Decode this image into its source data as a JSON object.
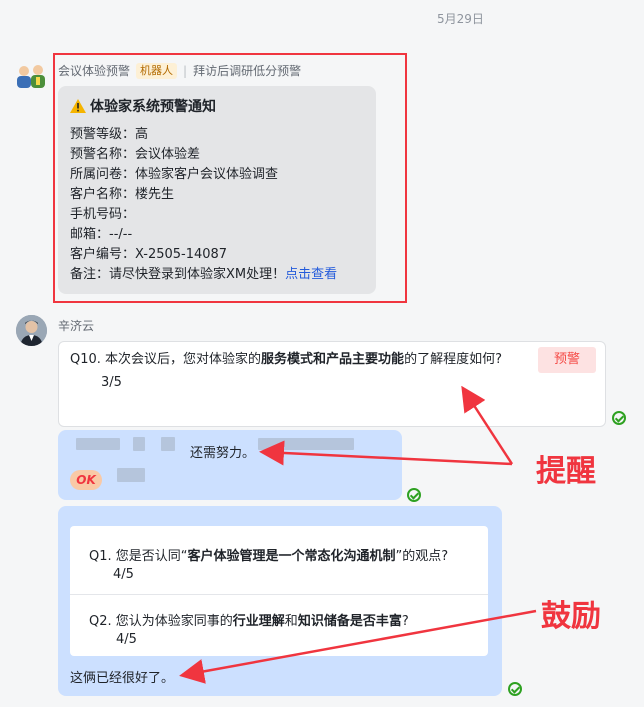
{
  "date_label": "5月29日",
  "robot_message": {
    "sender": "会议体验预警",
    "badge": "机器人",
    "subtitle": "拜访后调研低分预警",
    "card": {
      "title": "体验家系统预警通知",
      "rows": [
        "预警等级：高",
        "预警名称：会议体验差",
        "所属问卷：体验家客户会议体验调查",
        "客户名称：楼先生",
        "手机号码：",
        "邮箱：--/--",
        "客户编号：X-2505-14087"
      ],
      "note_prefix": "备注：请尽快登录到体验家XM处理！",
      "note_link": "点击查看"
    }
  },
  "person_message": {
    "sender": "辛济云",
    "q10": {
      "prefix": "Q10. 本次会议后，您对体验家的",
      "bold1": "服务模式和产品主要功能",
      "suffix": "的了解程度如何?",
      "score": "3/5",
      "tag": "预警"
    },
    "reply1": "还需努力。",
    "ok_badge": "OK",
    "q1": {
      "prefix": "Q1. 您是否认同“",
      "bold": "客户体验管理是一个常态化沟通机制",
      "suffix": "”的观点?",
      "score": "4/5"
    },
    "q2": {
      "prefix": "Q2. 您认为体验家同事的",
      "bold1": "行业理解",
      "mid": "和",
      "bold2": "知识储备是否丰富",
      "suffix": "?",
      "score": "4/5"
    },
    "reply2": "这俩已经很好了。"
  },
  "annotations": {
    "remind": "提醒",
    "encourage": "鼓励"
  },
  "colors": {
    "annotation_red": "#f0353f",
    "bubble_blue": "#cce0ff",
    "link_blue": "#245bdb",
    "tick_green": "#2ea121"
  }
}
